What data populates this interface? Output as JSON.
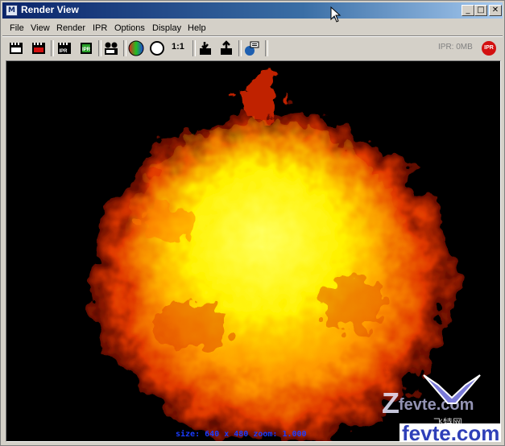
{
  "window": {
    "title": "Render View",
    "app_icon": "maya-icon"
  },
  "title_buttons": [
    {
      "name": "minimize-button",
      "glyph": "_"
    },
    {
      "name": "maximize-button",
      "glyph": "□"
    },
    {
      "name": "close-button",
      "glyph": "✕"
    }
  ],
  "menu": [
    "File",
    "View",
    "Render",
    "IPR",
    "Options",
    "Display",
    "Help"
  ],
  "toolbar": {
    "icons": [
      "redo-render-icon",
      "render-region-icon",
      "ipr-render-icon",
      "refresh-ipr-icon",
      "snapshot-icon",
      "rgb-channels-icon",
      "alpha-channel-icon",
      "real-size-icon",
      "keep-image-icon",
      "remove-image-icon",
      "render-globals-icon"
    ],
    "ipr_label": "IPR",
    "ratio_label": "1:1",
    "ipr_memory": "IPR: 0MB",
    "ipr_stop_label": "IPR"
  },
  "status": {
    "text": "size:  640 x 480 zoom: 1.000"
  },
  "watermark": {
    "top_text": "fevte.com",
    "bottom_text": "fevte.com",
    "brand": "飞特网",
    "zf_text": "Z"
  },
  "colors": {
    "title_start": "#0a246a",
    "title_end": "#a6caf0",
    "status": "#1a3cff",
    "stop": "#d31010"
  }
}
